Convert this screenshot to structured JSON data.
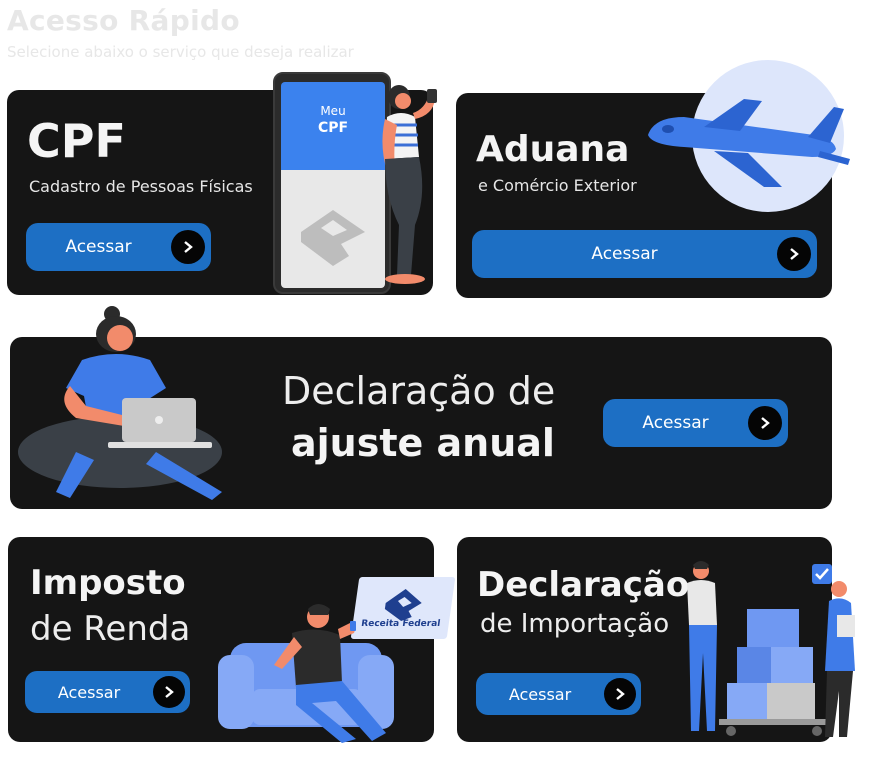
{
  "header": {
    "title": "Acesso Rápido",
    "subtitle": "Selecione abaixo o serviço que deseja realizar"
  },
  "cards": {
    "cpf": {
      "title": "CPF",
      "subtitle": "Cadastro de Pessoas Físicas",
      "button": "Acessar",
      "phone_text_1": "Meu",
      "phone_text_2": "CPF"
    },
    "aduana": {
      "title": "Aduana",
      "subtitle": "e Comércio Exterior",
      "button": "Acessar"
    },
    "ajuste": {
      "line1": "Declaração de",
      "line2": "ajuste anual",
      "button": "Acessar"
    },
    "imposto": {
      "line1": "Imposto",
      "line2": "de Renda",
      "button": "Acessar",
      "sign_text": "Receita Federal"
    },
    "importacao": {
      "line1": "Declaração",
      "line2": "de Importação",
      "button": "Acessar"
    }
  },
  "colors": {
    "card_bg": "#151515",
    "accent_blue": "#1d6fc4",
    "illustration_blue": "#3f7be8",
    "muted_heading": "#e7e7e7"
  },
  "icons": [
    "chevron-right-icon",
    "airplane-icon",
    "globe-icon",
    "phone-icon",
    "laptop-icon",
    "receita-federal-logo",
    "checkbox-icon",
    "boxes-icon"
  ]
}
